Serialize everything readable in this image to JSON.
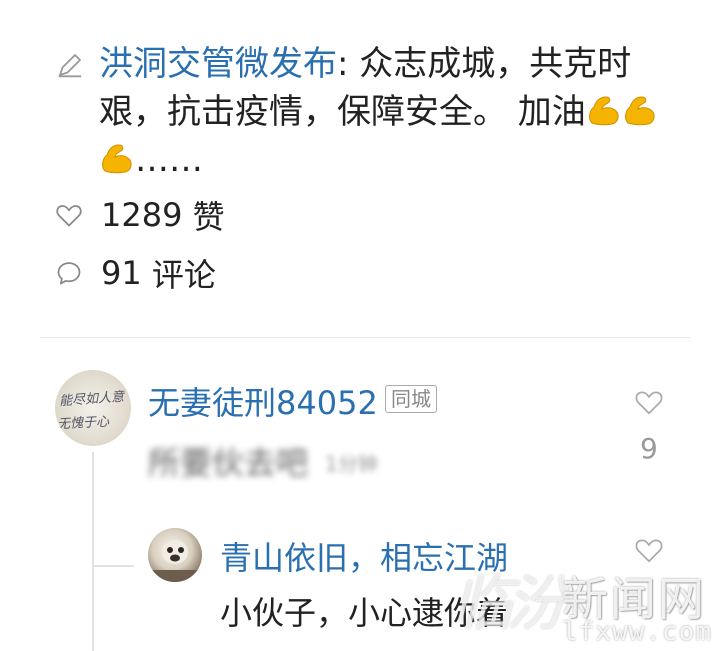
{
  "post": {
    "author": "洪洞交管微发布",
    "separator": ": ",
    "text": "众志成城，共克时艰，抗击疫情，保障安全。 加油",
    "ellipsis": "……",
    "emoji_icon": "flexed-biceps-icon"
  },
  "stats": {
    "likes_count": "1289",
    "likes_label": "赞",
    "comments_count": "91",
    "comments_label": "评论"
  },
  "comments": [
    {
      "username": "无妻徒刑84052",
      "badge": "同城",
      "text": "所要伙去吧",
      "extra": "1分钟",
      "like_count": "9"
    },
    {
      "username": "青山依旧，相忘江湖",
      "text": "小伙子，小心逮你着"
    }
  ],
  "avatar1_text": [
    "能尽如人意",
    "无愧于心"
  ],
  "watermark": {
    "logo": "临汾",
    "title": "新闻网",
    "url": "lfxww.com"
  },
  "colors": {
    "link": "#2a6fb0",
    "text": "#222222",
    "muted": "#999999",
    "emoji": "#f4b400"
  }
}
